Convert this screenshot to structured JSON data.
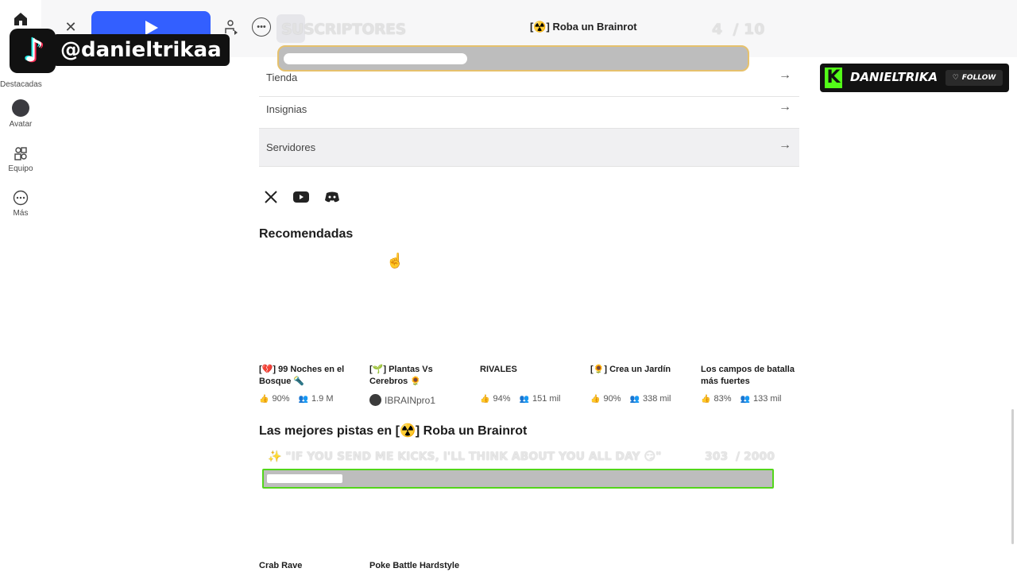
{
  "sidebar": {
    "items": [
      {
        "label": "Destacadas",
        "icon": "home-icon"
      },
      {
        "label": "Avatar",
        "icon": "avatar-icon"
      },
      {
        "label": "Equipo",
        "icon": "team-icon"
      },
      {
        "label": "Más",
        "icon": "more-icon"
      }
    ]
  },
  "topbar": {
    "game_title": "[☢️] Roba un Brainrot"
  },
  "overlay": {
    "subs_label": "SUSCRIPTORES",
    "subs_current": "4",
    "subs_goal": "/ 10",
    "subs_progress": 0.4,
    "tiktok_handle": "@danieltrikaa",
    "kick_name": "DANIELTRIKA",
    "kick_follow": "FOLLOW",
    "goal_text": "✨ \"IF YOU SEND ME KICKS, I'LL THINK ABOUT YOU ALL DAY 😏\"",
    "goal_current": "303",
    "goal_total": "/ 2000",
    "goal_progress": 0.15
  },
  "menu": [
    {
      "label": "Tienda"
    },
    {
      "label": "Insignias"
    },
    {
      "label": "Servidores"
    }
  ],
  "social": [
    "x-icon",
    "youtube-icon",
    "discord-icon"
  ],
  "recommended": {
    "title": "Recomendadas",
    "cards": [
      {
        "title": "[💔] 99 Noches en el Bosque 🔦",
        "rating": "90%",
        "players": "1.9 M"
      },
      {
        "title": "[🌱] Plantas Vs Cerebros 🌻",
        "creator": "IBRAINpro1"
      },
      {
        "title": "RIVALES",
        "rating": "94%",
        "players": "151 mil"
      },
      {
        "title": "[🌻] Crea un Jardín",
        "rating": "90%",
        "players": "338 mil"
      },
      {
        "title": "Los campos de batalla más fuertes",
        "rating": "83%",
        "players": "133 mil"
      }
    ]
  },
  "tracks": {
    "title": "Las mejores pistas en [☢️] Roba un Brainrot",
    "items": [
      "Crab Rave",
      "Poke Battle Hardstyle"
    ]
  }
}
